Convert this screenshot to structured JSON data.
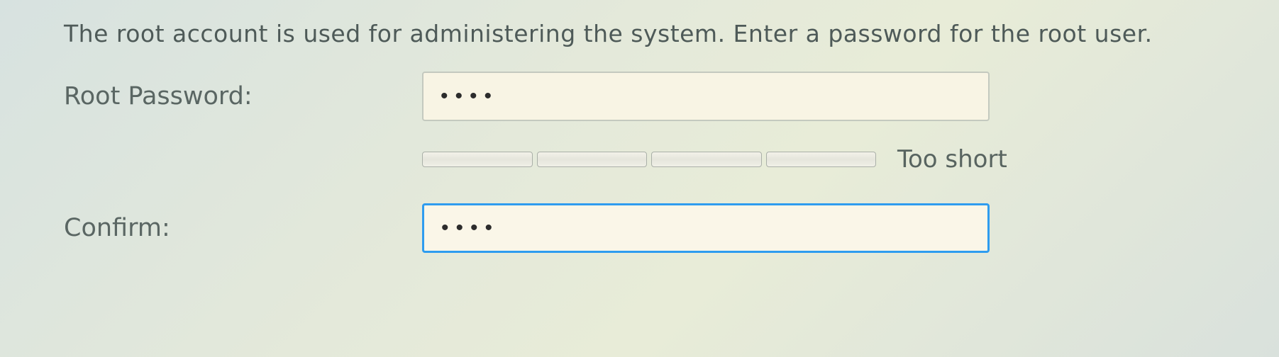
{
  "instruction": "The root account is used for administering the system.  Enter a password for the root user.",
  "fields": {
    "root_password": {
      "label": "Root Password:",
      "value": "••••"
    },
    "confirm": {
      "label": "Confirm:",
      "value": "••••"
    }
  },
  "strength": {
    "segments": 4,
    "filled": 0,
    "label": "Too short"
  }
}
